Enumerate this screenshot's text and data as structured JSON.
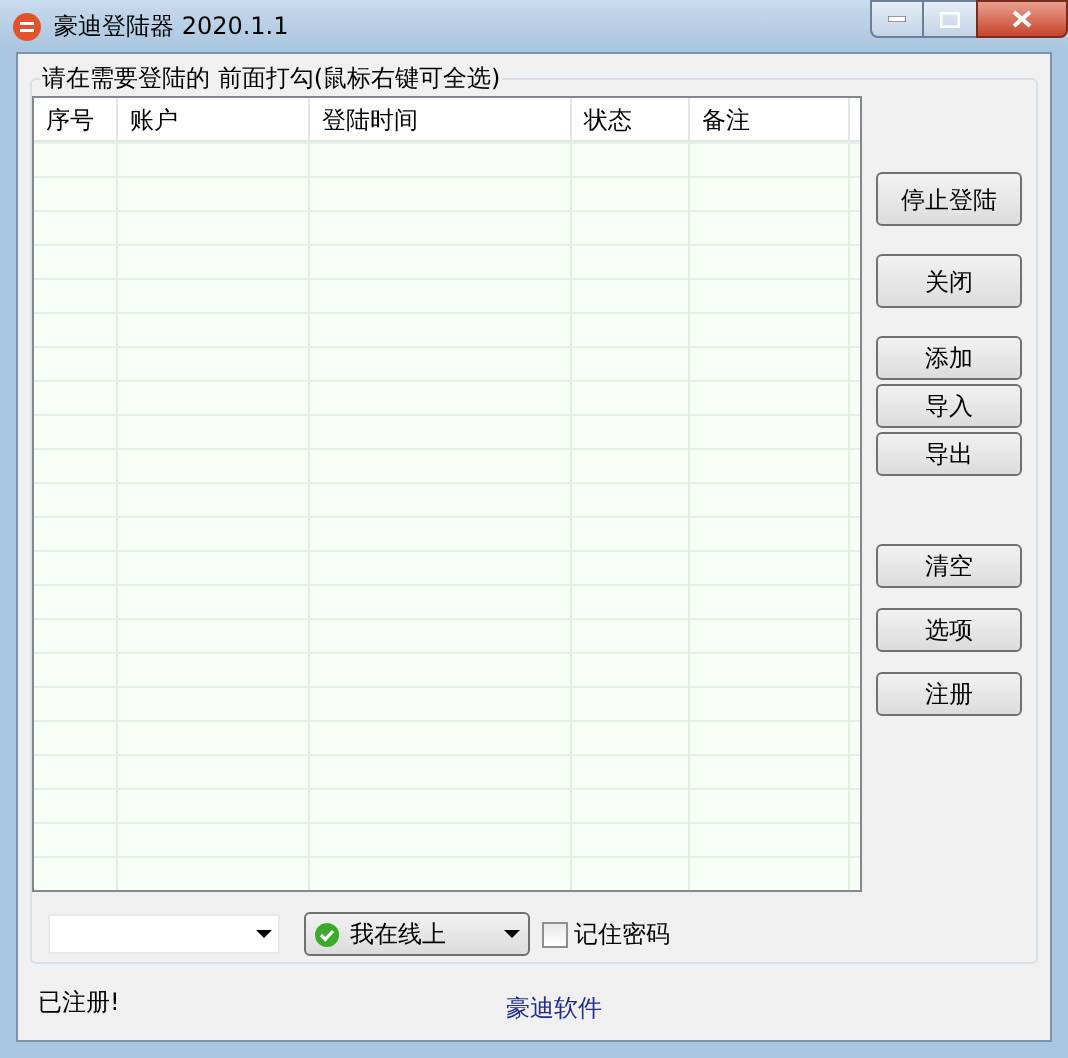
{
  "window": {
    "title": "豪迪登陆器 2020.1.1"
  },
  "group": {
    "caption": "请在需要登陆的 前面打勾(鼠标右键可全选)"
  },
  "table": {
    "columns": [
      "序号",
      "账户",
      "登陆时间",
      "状态",
      "备注"
    ]
  },
  "buttons": [
    {
      "label": "停止登陆"
    },
    {
      "label": "关闭"
    },
    {
      "label": "添加"
    },
    {
      "label": "导入"
    },
    {
      "label": "导出"
    },
    {
      "label": "清空"
    },
    {
      "label": "选项"
    },
    {
      "label": "注册"
    }
  ],
  "status_combo": {
    "value": "我在线上"
  },
  "remember_password": {
    "label": "记住密码",
    "checked": false
  },
  "status_bar": {
    "left": "已注册!",
    "right": "豪迪软件"
  }
}
